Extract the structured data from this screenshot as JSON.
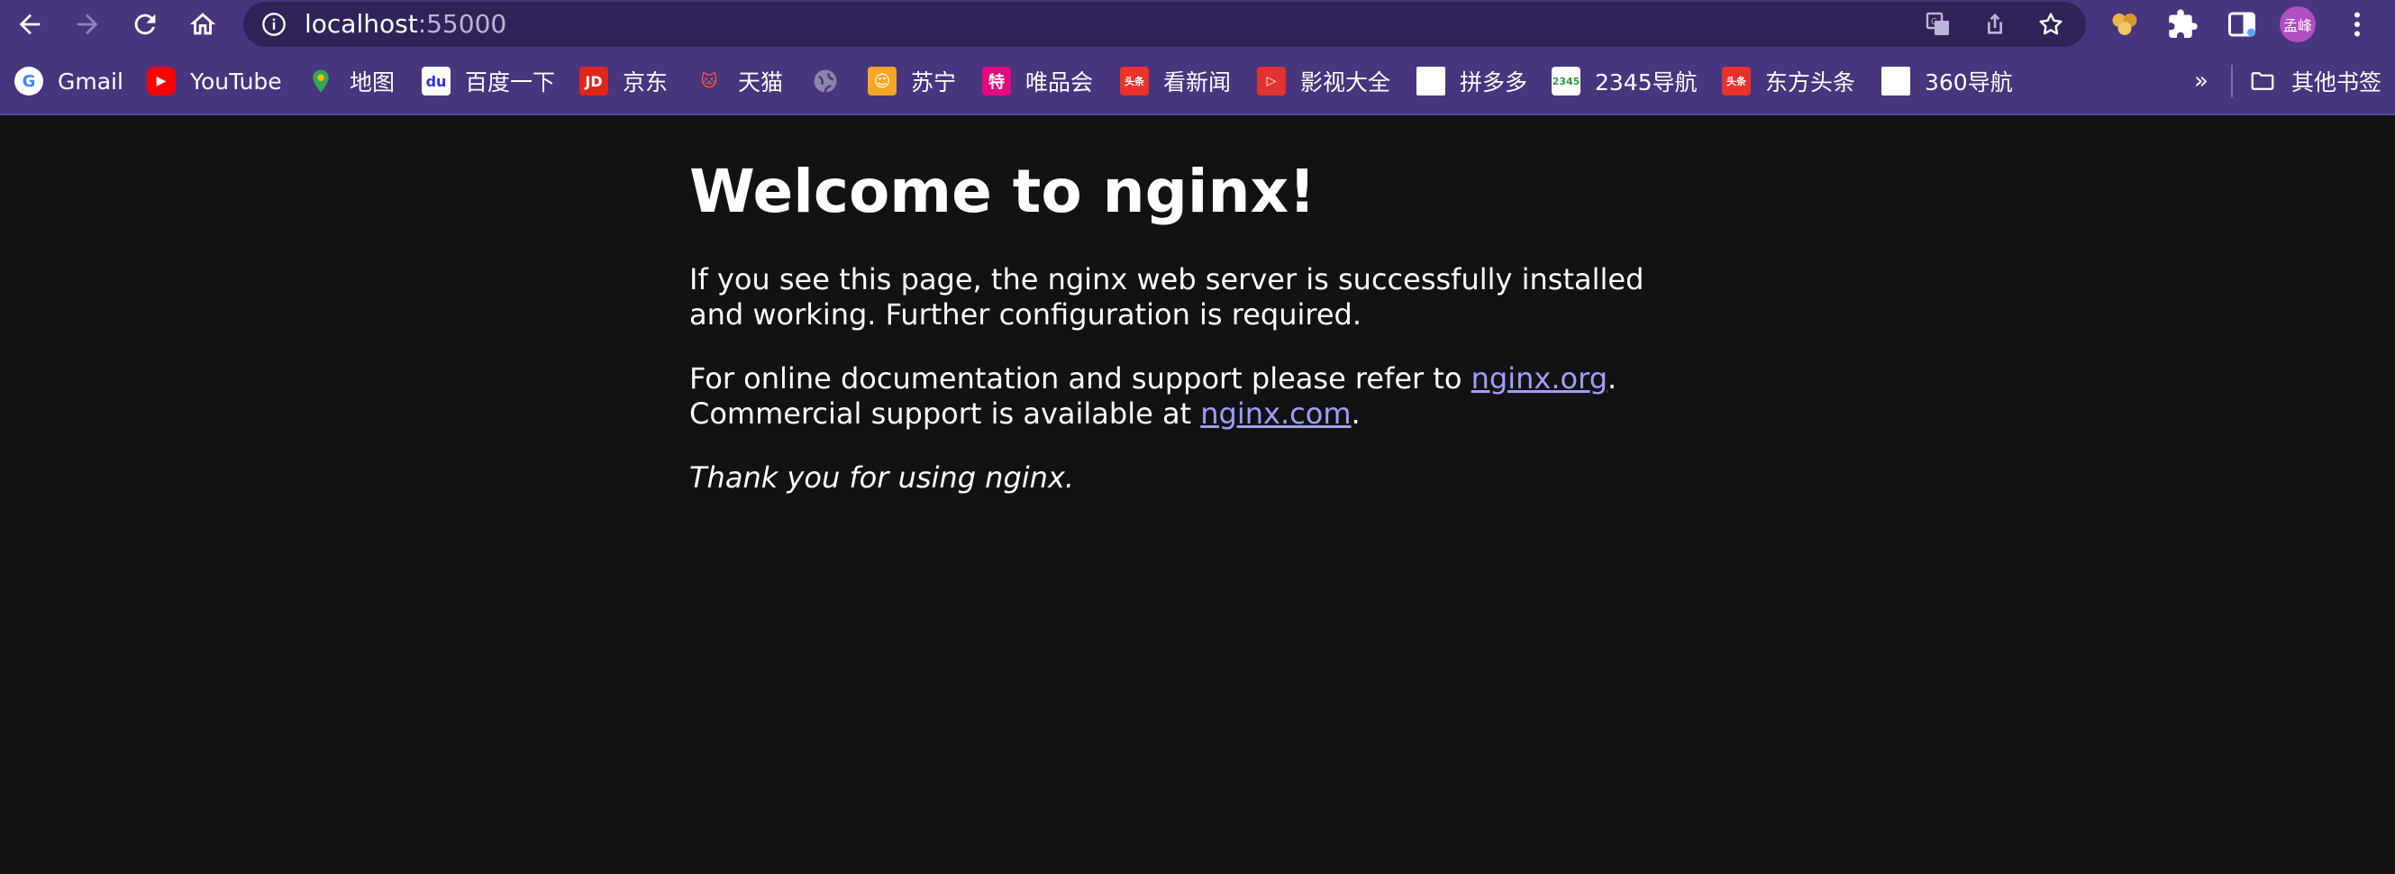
{
  "browser": {
    "url_host": "localhost",
    "url_port": ":55000",
    "profile_label": "孟峰"
  },
  "bookmarks": [
    {
      "label": "Gmail",
      "icon": "google-icon"
    },
    {
      "label": "YouTube",
      "icon": "youtube-icon"
    },
    {
      "label": "地图",
      "icon": "maps-icon"
    },
    {
      "label": "百度一下",
      "icon": "baidu-icon"
    },
    {
      "label": "京东",
      "icon": "jd-icon"
    },
    {
      "label": "天猫",
      "icon": "tmall-icon"
    },
    {
      "label": "",
      "icon": "globe-icon"
    },
    {
      "label": "苏宁",
      "icon": "suning-icon"
    },
    {
      "label": "唯品会",
      "icon": "vip-icon"
    },
    {
      "label": "看新闻",
      "icon": "toutiao-icon"
    },
    {
      "label": "影视大全",
      "icon": "video-icon"
    },
    {
      "label": "拼多多",
      "icon": "blank-page-icon"
    },
    {
      "label": "2345导航",
      "icon": "2345-icon"
    },
    {
      "label": "东方头条",
      "icon": "toutiao-icon"
    },
    {
      "label": "360导航",
      "icon": "blank-page-icon"
    }
  ],
  "bookmarks_overflow": "»",
  "other_bookmarks": "其他书签",
  "page": {
    "heading": "Welcome to nginx!",
    "para1": "If you see this page, the nginx web server is successfully installed and working. Further configuration is required.",
    "para2_prefix": "For online documentation and support please refer to ",
    "link_org": "nginx.org",
    "para2_mid": ".",
    "para2_line2": "Commercial support is available at ",
    "link_com": "nginx.com",
    "para2_end": ".",
    "thanks": "Thank you for using nginx."
  },
  "colors": {
    "toolbar_bg": "#47357e",
    "omnibox_bg": "#2f2358",
    "page_bg": "#121212",
    "link": "#9e9eff"
  }
}
